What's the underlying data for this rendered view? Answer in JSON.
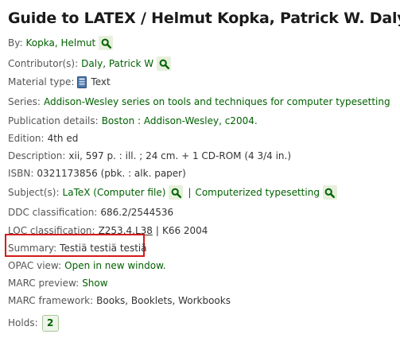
{
  "record": {
    "title": "Guide to LATEX / Helmut Kopka, Patrick W. Daly.",
    "by_label": "By:",
    "author": "Kopka, Helmut",
    "contributors_label": "Contributor(s):",
    "contributor": "Daly, Patrick W",
    "material_type_label": "Material type:",
    "material_type": "Text",
    "series_label": "Series:",
    "series": "Addison-Wesley series on tools and techniques for computer typesetting",
    "publication_label": "Publication details:",
    "publication": "Boston : Addison-Wesley, c2004.",
    "edition_label": "Edition:",
    "edition": "4th ed",
    "description_label": "Description:",
    "description": "xii, 597 p. : ill. ; 24 cm. + 1 CD-ROM (4 3/4 in.)",
    "isbn_label": "ISBN:",
    "isbn": "0321173856 (pbk. : alk. paper)",
    "subjects_label": "Subject(s):",
    "subjects": [
      "LaTeX (Computer file)",
      "Computerized typesetting"
    ],
    "subject_separator": "|",
    "ddc_label": "DDC classification:",
    "ddc": "686.2/2544536",
    "loc_label": "LOC classification:",
    "loc_link": "Z253.4.L38",
    "loc_separator": "|",
    "loc_rest": "K66 2004",
    "summary_label": "Summary:",
    "summary": "Testiä testiä testiä",
    "opac_label": "OPAC view:",
    "opac_link": "Open in new window.",
    "marc_preview_label": "MARC preview:",
    "marc_preview_link": "Show",
    "marc_framework_label": "MARC framework:",
    "marc_framework": "Books, Booklets, Workbooks",
    "holds_label": "Holds:",
    "holds_count": "2"
  },
  "icons": {
    "search": "search-icon",
    "book": "book-icon"
  },
  "colors": {
    "link": "#006100",
    "highlight": "#d61a1a",
    "search_button_bg": "#e6f0dc"
  }
}
